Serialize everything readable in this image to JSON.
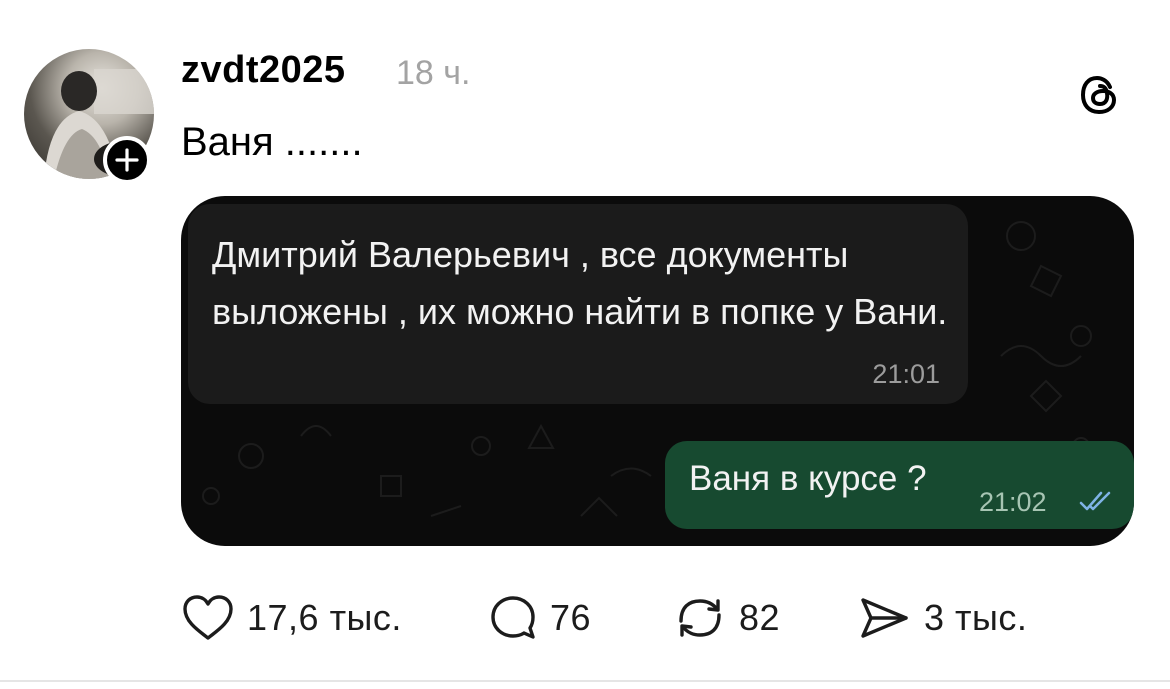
{
  "post": {
    "username": "zvdt2025",
    "time": "18 ч.",
    "text": "Ваня ......."
  },
  "chat": {
    "incoming": {
      "text": "Дмитрий Валерьевич , все документы выложены , их можно найти в попке у Вани.",
      "time": "21:01"
    },
    "outgoing": {
      "text": "Ваня в курсе ?",
      "time": "21:02",
      "status_icon": "double-check-icon"
    }
  },
  "actions": {
    "likes": "17,6 тыс.",
    "replies": "76",
    "reposts": "82",
    "shares": "3 тыс."
  },
  "colors": {
    "accent_outgoing": "#174a30",
    "chat_background": "#0b0b0b",
    "incoming_bubble": "#1b1b1b",
    "secondary_text": "#a3a3a3"
  }
}
